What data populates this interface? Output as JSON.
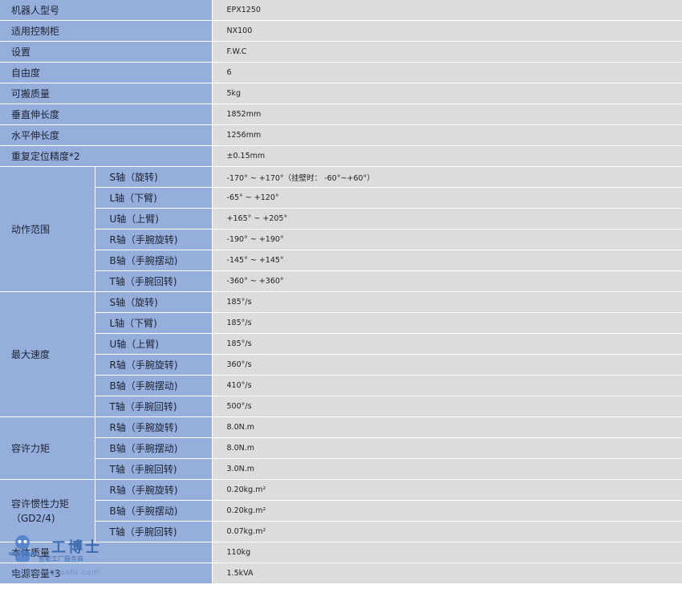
{
  "rows": {
    "model": {
      "label": "机器人型号",
      "value": "EPX1250"
    },
    "controller": {
      "label": "适用控制柜",
      "value": "NX100"
    },
    "setting": {
      "label": "设置",
      "value": "F.W.C"
    },
    "dof": {
      "label": "自由度",
      "value": "6"
    },
    "payload": {
      "label": "可搬质量",
      "value": "5kg"
    },
    "vertical_reach": {
      "label": "垂直伸长度",
      "value": "1852mm"
    },
    "horizontal_reach": {
      "label": "水平伸长度",
      "value": "1256mm"
    },
    "repeatability": {
      "label": "重复定位精度*2",
      "value": "±0.15mm"
    },
    "motion_range": {
      "label": "动作范围",
      "items": [
        {
          "axis": "S轴（旋转)",
          "value": "-170° ~ +170°（挂壁时： -60°~+60°）"
        },
        {
          "axis": "L轴（下臂)",
          "value": "-65° ~ +120°"
        },
        {
          "axis": "U轴（上臂)",
          "value": "+165° ~ +205°"
        },
        {
          "axis": "R轴（手腕旋转)",
          "value": "-190° ~ +190°"
        },
        {
          "axis": "B轴（手腕摆动)",
          "value": "-145° ~ +145°"
        },
        {
          "axis": "T轴（手腕回转)",
          "value": "-360° ~ +360°"
        }
      ]
    },
    "max_speed": {
      "label": "最大速度",
      "items": [
        {
          "axis": "S轴（旋转)",
          "value": "185°/s"
        },
        {
          "axis": "L轴（下臂)",
          "value": "185°/s"
        },
        {
          "axis": "U轴（上臂)",
          "value": "185°/s"
        },
        {
          "axis": "R轴（手腕旋转)",
          "value": "360°/s"
        },
        {
          "axis": "B轴（手腕摆动)",
          "value": "410°/s"
        },
        {
          "axis": "T轴（手腕回转)",
          "value": "500°/s"
        }
      ]
    },
    "torque": {
      "label": "容许力矩",
      "items": [
        {
          "axis": "R轴（手腕旋转)",
          "value": "8.0N.m"
        },
        {
          "axis": "B轴（手腕摆动)",
          "value": "8.0N.m"
        },
        {
          "axis": "T轴（手腕回转)",
          "value": "3.0N.m"
        }
      ]
    },
    "inertia": {
      "label": "容许惯性力矩",
      "label2": "（GD2/4)",
      "items": [
        {
          "axis": "R轴（手腕旋转)",
          "value": "0.20kg.m²"
        },
        {
          "axis": "B轴（手腕摆动)",
          "value": "0.20kg.m²"
        },
        {
          "axis": "T轴（手腕回转)",
          "value": "0.07kg.m²"
        }
      ]
    },
    "mass": {
      "label": "本体质量",
      "value": "110kg"
    },
    "power": {
      "label": "电源容量*3",
      "value": "1.5kVA"
    }
  },
  "watermark": {
    "title": "工博士",
    "subtitle": "智能工厂服务商",
    "url": "www.gongboshi.com",
    "accent": "#2d5fa6"
  },
  "colors": {
    "label_bg": "#95aedb",
    "value_bg": "#dcdcdc"
  }
}
